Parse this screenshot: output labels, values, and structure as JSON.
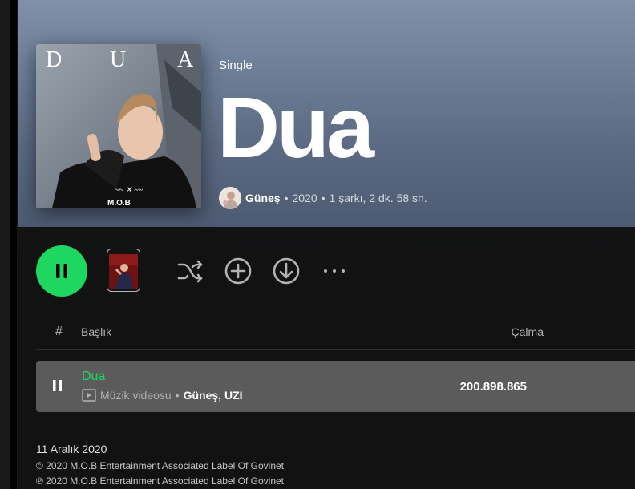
{
  "album": {
    "type_label": "Single",
    "title": "Dua",
    "cover_letters": [
      "D",
      "U",
      "A"
    ],
    "cover_label_logo": "M.O.B",
    "artist": "Güneş",
    "year": "2020",
    "track_count": "1 şarkı, 2 dk. 58 sn."
  },
  "controls": {
    "play_state": "pause-icon",
    "icons": [
      "shuffle-icon",
      "add-circle-icon",
      "download-icon",
      "more-icon"
    ],
    "accent": "#1ed760"
  },
  "table": {
    "headers": {
      "num": "#",
      "title": "Başlık",
      "plays": "Çalma"
    },
    "tracks": [
      {
        "title": "Dua",
        "type": "Müzik videosu",
        "artists": "Güneş, UZI",
        "plays": "200.898.865"
      }
    ]
  },
  "footer": {
    "release_date": "11 Aralık 2020",
    "copyright_c": "© 2020 M.O.B Entertainment Associated Label Of Govinet",
    "copyright_p": "℗ 2020 M.O.B Entertainment Associated Label Of Govinet"
  }
}
